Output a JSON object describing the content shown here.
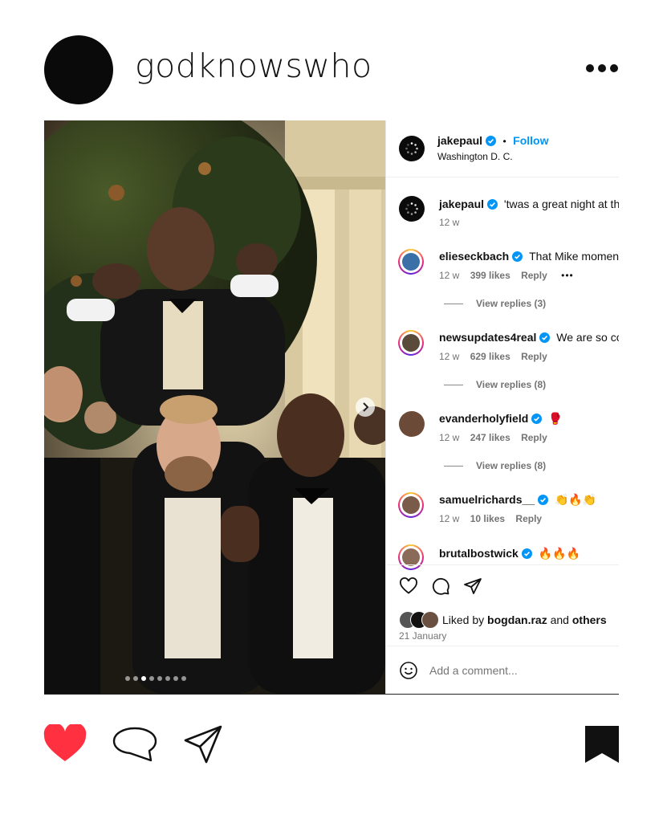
{
  "post": {
    "username": "godknowswho"
  },
  "embedded": {
    "header": {
      "username": "jakepaul",
      "separator": "•",
      "follow_label": "Follow",
      "location": "Washington D. C."
    },
    "caption": {
      "username": "jakepaul",
      "text": "'twas a great night at the White House",
      "time": "12 w"
    },
    "comments": [
      {
        "username": "elieseckbach",
        "text": "That Mike moment was legendary",
        "time": "12 w",
        "likes": "399 likes",
        "reply": "Reply",
        "more": "•••",
        "view_replies": "View replies (3)",
        "avatar_color": "#3b6fa8"
      },
      {
        "username": "newsupdates4real",
        "text": "We are so cooked",
        "time": "12 w",
        "likes": "629 likes",
        "reply": "Reply",
        "view_replies": "View replies (8)",
        "avatar_color": "#5a4a3a"
      },
      {
        "username": "evanderholyfield",
        "text": "🥊",
        "time": "12 w",
        "likes": "247 likes",
        "reply": "Reply",
        "view_replies": "View replies (8)",
        "avatar_color": "#6b4a38"
      },
      {
        "username": "samuelrichards__",
        "text": "👏🔥👏",
        "time": "12 w",
        "likes": "10 likes",
        "reply": "Reply",
        "avatar_color": "#7a5a48"
      },
      {
        "username": "brutalbostwick",
        "text": "🔥🔥🔥",
        "avatar_color": "#8a6a58"
      }
    ],
    "likes": {
      "prefix": "Liked by",
      "user": "bogdan.raz",
      "middle": "and",
      "others": "others",
      "date": "21 January"
    },
    "comment_box": {
      "placeholder": "Add a comment..."
    },
    "carousel": {
      "slide_count": 8,
      "active_index": 2
    }
  },
  "colors": {
    "liked_heart": "#ff3040",
    "follow_blue": "#0095f6",
    "verified_blue": "#0095f6"
  },
  "icons": [
    "more-icon",
    "verified-icon",
    "chevron-right-icon",
    "heart-icon",
    "comment-icon",
    "share-icon",
    "emoji-icon",
    "bookmark-icon"
  ]
}
